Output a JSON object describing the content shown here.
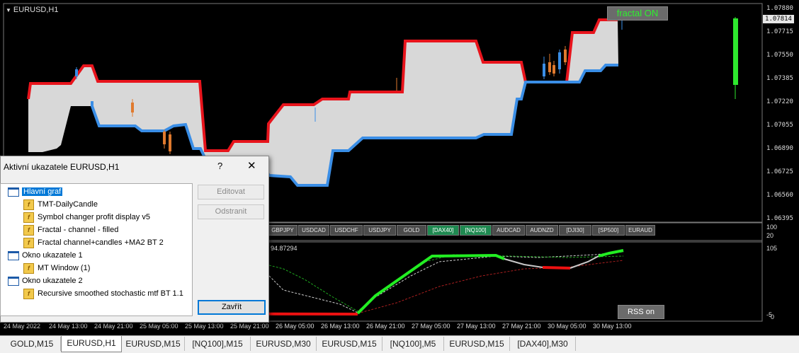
{
  "chart": {
    "title": "EURUSD,H1",
    "fractal_button": "fractal ON",
    "rss_button": "RSS on",
    "price_labels": [
      "1.07880",
      "1.07715",
      "1.07550",
      "1.07385",
      "1.07220",
      "1.07055",
      "1.06890",
      "1.06725",
      "1.06560",
      "1.06395"
    ],
    "current_price": "1.07814",
    "symbol_buttons": [
      {
        "label": "GBPJPY",
        "active": false
      },
      {
        "label": "USDCAD",
        "active": false
      },
      {
        "label": "USDCHF",
        "active": false
      },
      {
        "label": "USDJPY",
        "active": false
      },
      {
        "label": "GOLD",
        "active": false
      },
      {
        "label": "[DAX40]",
        "active": true
      },
      {
        "label": "[NQ100]",
        "active": true
      },
      {
        "label": "AUDCAD",
        "active": false
      },
      {
        "label": "AUDNZD",
        "active": false
      },
      {
        "label": "[DJI30]",
        "active": false
      },
      {
        "label": "[SP500]",
        "active": false
      },
      {
        "label": "EURAUD",
        "active": false
      }
    ],
    "mini_scale": [
      "100",
      "20"
    ],
    "subwindow_value": "94.87294",
    "subwindow_scale": [
      "105",
      "-5",
      "0"
    ],
    "time_labels": [
      "24 May 2022",
      "24 May 13:00",
      "24 May 21:00",
      "25 May 05:00",
      "25 May 13:00",
      "25 May 21:00",
      "26 May 05:00",
      "26 May 13:00",
      "26 May 21:00",
      "27 May 05:00",
      "27 May 13:00",
      "27 May 21:00",
      "30 May 05:00",
      "30 May 13:00"
    ],
    "colors": {
      "upper_band": "#e8141c",
      "lower_band": "#3a8ee6",
      "fill": "#d8d8d8",
      "stoch_up": "#22ee22",
      "stoch_down": "#ee1111",
      "stoch_flat": "#c8c8c8"
    }
  },
  "dialog": {
    "title": "Aktivní ukazatele EURUSD,H1",
    "help": "?",
    "close": "✕",
    "tree": [
      {
        "type": "window",
        "label": "Hlavní graf",
        "selected": true
      },
      {
        "type": "indicator",
        "label": "TMT-DailyCandle"
      },
      {
        "type": "indicator",
        "label": "Symbol changer profit display v5"
      },
      {
        "type": "indicator",
        "label": "Fractal - channel - filled"
      },
      {
        "type": "indicator",
        "label": "Fractal channel+candles +MA2  BT 2"
      },
      {
        "type": "window",
        "label": "Okno ukazatele 1"
      },
      {
        "type": "indicator",
        "label": "MT Window (1)"
      },
      {
        "type": "window",
        "label": "Okno ukazatele 2"
      },
      {
        "type": "indicator",
        "label": "Recursive smoothed stochastic mtf BT 1.1"
      }
    ],
    "buttons": {
      "edit": "Editovat",
      "remove": "Odstranit",
      "close": "Zavřít"
    }
  },
  "tabs": [
    {
      "label": "GOLD,M15",
      "active": false
    },
    {
      "label": "EURUSD,H1",
      "active": true
    },
    {
      "label": "EURUSD,M15",
      "active": false
    },
    {
      "label": "[NQ100],M15",
      "active": false
    },
    {
      "label": "EURUSD,M30",
      "active": false
    },
    {
      "label": "EURUSD,M15",
      "active": false
    },
    {
      "label": "[NQ100],M5",
      "active": false
    },
    {
      "label": "EURUSD,M15",
      "active": false
    },
    {
      "label": "[DAX40],M30",
      "active": false
    }
  ]
}
